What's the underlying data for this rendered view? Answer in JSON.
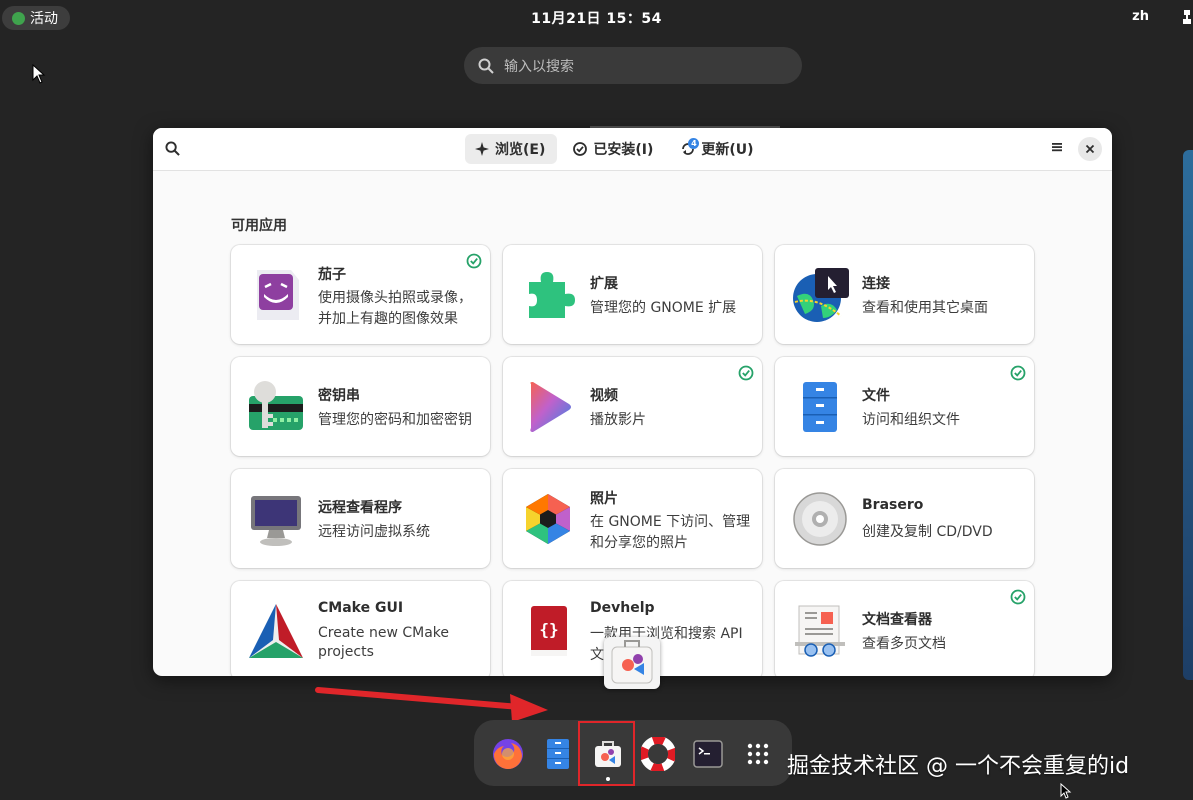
{
  "topbar": {
    "activities_label": "活动",
    "clock": "11月21日  15：54",
    "lang": "zh"
  },
  "overview_search": {
    "placeholder": "输入以搜索"
  },
  "window": {
    "tabs": [
      {
        "label": "浏览(E)",
        "icon": "sparkle-icon",
        "active": true
      },
      {
        "label": "已安装(I)",
        "icon": "check-circle-icon",
        "active": false
      },
      {
        "label": "更新(U)",
        "icon": "refresh-icon",
        "badge": "4",
        "active": false
      }
    ],
    "section_title": "可用应用",
    "apps": [
      {
        "name": "茄子",
        "desc": "使用摄像头拍照或录像，\n并加上有趣的图像效果",
        "icon": "cheese-icon",
        "installed": true
      },
      {
        "name": "扩展",
        "desc": "管理您的 GNOME 扩展",
        "icon": "extensions-icon",
        "installed": false
      },
      {
        "name": "连接",
        "desc": "查看和使用其它桌面",
        "icon": "connections-icon",
        "installed": false
      },
      {
        "name": "密钥串",
        "desc": "管理您的密码和加密密钥",
        "icon": "keyring-icon",
        "installed": false
      },
      {
        "name": "视频",
        "desc": "播放影片",
        "icon": "videos-icon",
        "installed": true
      },
      {
        "name": "文件",
        "desc": "访问和组织文件",
        "icon": "files-icon",
        "installed": true
      },
      {
        "name": "远程查看程序",
        "desc": "远程访问虚拟系统",
        "icon": "remote-viewer-icon",
        "installed": false
      },
      {
        "name": "照片",
        "desc": "在 GNOME 下访问、管理\n和分享您的照片",
        "icon": "photos-icon",
        "installed": false
      },
      {
        "name": "Brasero",
        "desc": "创建及复制 CD/DVD",
        "icon": "brasero-icon",
        "installed": false
      },
      {
        "name": "CMake GUI",
        "desc": "Create new CMake\nprojects",
        "icon": "cmake-icon",
        "installed": false
      },
      {
        "name": "Devhelp",
        "desc": "一款用于浏览和搜索 API\n文档的工具",
        "icon": "devhelp-icon",
        "installed": false
      },
      {
        "name": "文档查看器",
        "desc": "查看多页文档",
        "icon": "document-viewer-icon",
        "installed": true
      }
    ]
  },
  "dash": {
    "items": [
      {
        "name": "firefox-icon"
      },
      {
        "name": "files-icon"
      },
      {
        "name": "software-icon",
        "running": true
      },
      {
        "name": "help-icon"
      },
      {
        "name": "terminal-icon"
      },
      {
        "name": "app-grid-icon"
      }
    ]
  },
  "watermark": "掘金技术社区 @ 一个不会重复的id",
  "colors": {
    "accent": "#3584e4",
    "check": "#26a269",
    "highlight": "#e0262a"
  }
}
